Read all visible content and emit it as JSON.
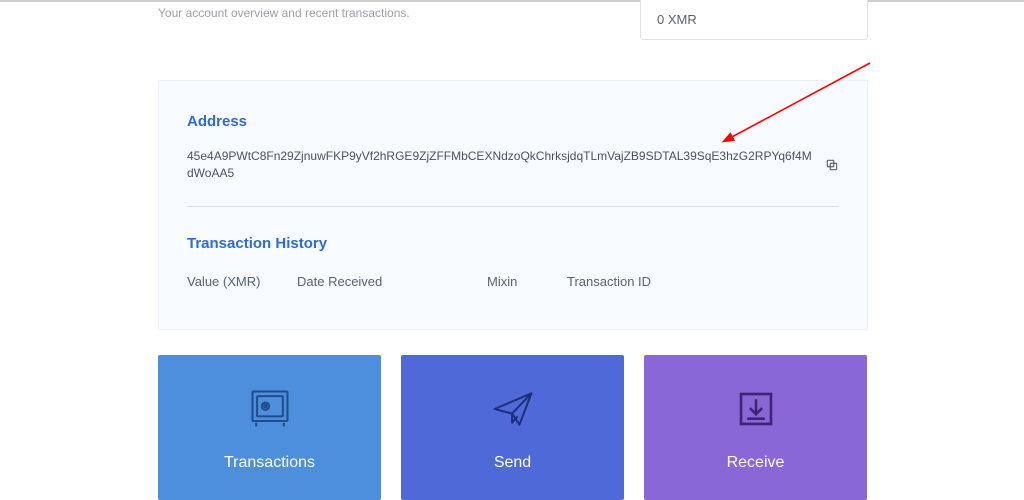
{
  "header": {
    "subtitle": "Your account overview and recent transactions."
  },
  "balance": {
    "value": "0 XMR"
  },
  "address": {
    "title": "Address",
    "value": "45e4A9PWtC8Fn29ZjnuwFKP9yVf2hRGE9ZjZFFMbCEXNdzoQkChrksjdqTLmVajZB9SDTAL39SqE3hzG2RPYq6f4MdWoAA5"
  },
  "history": {
    "title": "Transaction History",
    "columns": {
      "value": "Value (XMR)",
      "date": "Date Received",
      "mixin": "Mixin",
      "txid": "Transaction ID"
    }
  },
  "actions": {
    "transactions": "Transactions",
    "send": "Send",
    "receive": "Receive"
  },
  "colors": {
    "link": "#2f6bd8",
    "transactions": "#4e8fdd",
    "send": "#4f6ad8",
    "receive": "#8a67d6",
    "arrow": "#ff0000"
  }
}
